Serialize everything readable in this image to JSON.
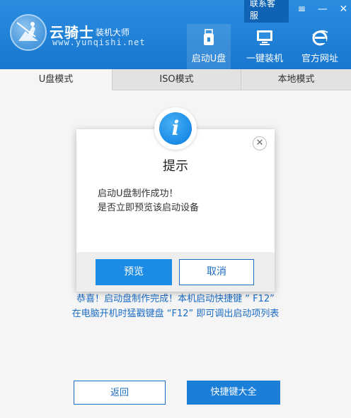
{
  "header": {
    "brand_name": "云骑士",
    "brand_sub": "装机大师",
    "brand_url": "www.yunqishi.net",
    "service_label": "联系客服",
    "menu_icon": "≡",
    "minimize_icon": "—",
    "close_icon": "✕",
    "nav": [
      {
        "label": "启动U盘",
        "icon": "usb-icon"
      },
      {
        "label": "一键装机",
        "icon": "monitor-icon"
      },
      {
        "label": "官方网址",
        "icon": "ie-browser-icon"
      }
    ]
  },
  "tabs": [
    {
      "label": "U盘模式",
      "active": true
    },
    {
      "label": "ISO模式",
      "active": false
    },
    {
      "label": "本地模式",
      "active": false
    }
  ],
  "content": {
    "congrats_line1": "恭喜！启动盘制作完成！本机启动快捷键 “ F12”",
    "congrats_line2": "在电脑开机时猛戳键盘 “F12” 即可调出启动项列表",
    "back_label": "返回",
    "hotkey_label": "快捷键大全"
  },
  "dialog": {
    "badge_glyph": "i",
    "title": "提示",
    "message_line1": "启动U盘制作成功！",
    "message_line2": "是否立即预览该启动设备",
    "close_glyph": "✕",
    "preview_label": "预览",
    "cancel_label": "取消"
  },
  "colors": {
    "header_blue": "#1877cf",
    "accent_blue": "#1b8be6",
    "text_blue": "#1a6cc4"
  }
}
